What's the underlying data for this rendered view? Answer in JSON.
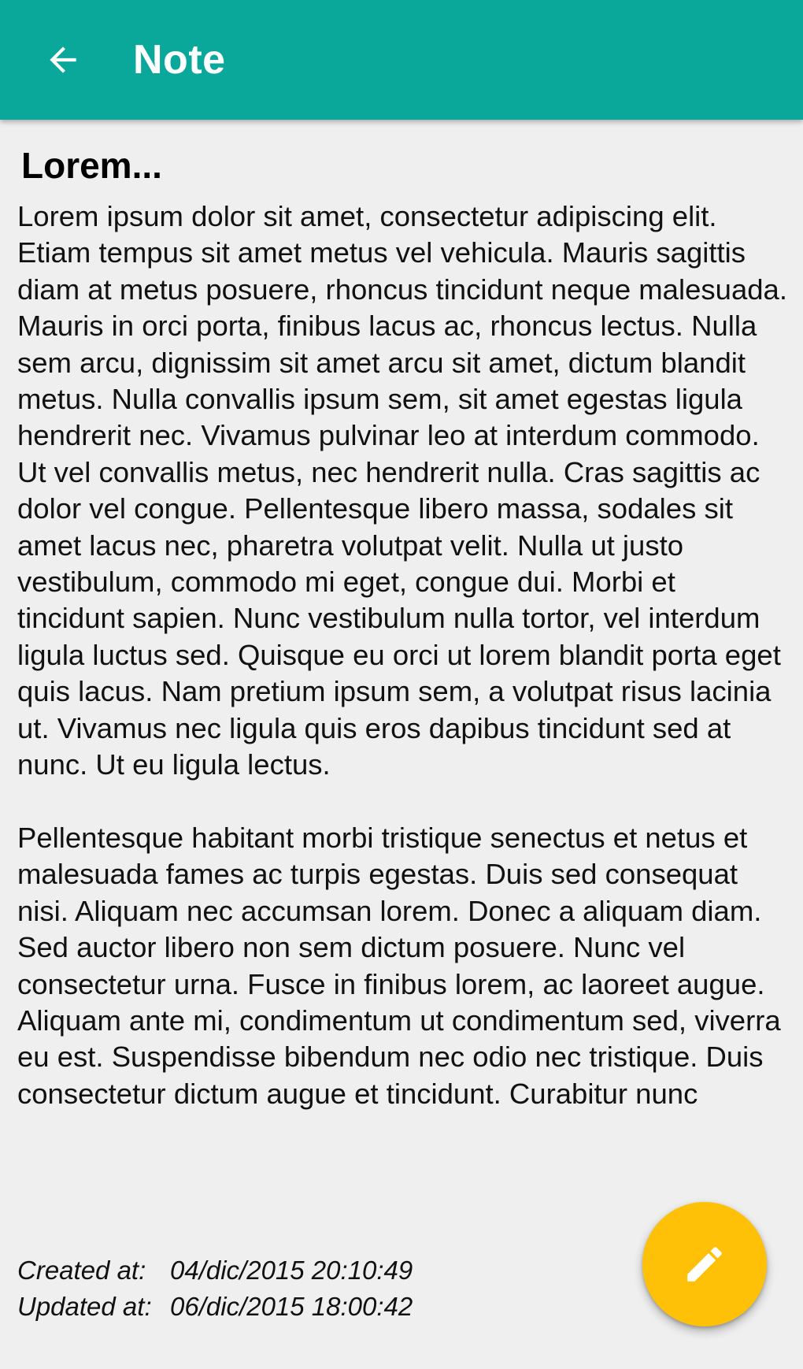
{
  "appbar": {
    "title": "Note",
    "back_icon": "arrow-left-icon",
    "background_color": "#0aa89a"
  },
  "note": {
    "title": "Lorem...",
    "body": "Lorem ipsum dolor sit amet, consectetur adipiscing elit. Etiam tempus sit amet metus vel vehicula. Mauris sagittis diam at metus posuere, rhoncus tincidunt neque malesuada. Mauris in orci porta, finibus lacus ac, rhoncus lectus. Nulla sem arcu, dignissim sit amet arcu sit amet, dictum blandit metus. Nulla convallis ipsum sem, sit amet egestas ligula hendrerit nec. Vivamus pulvinar leo at interdum commodo. Ut vel convallis metus, nec hendrerit nulla. Cras sagittis ac dolor vel congue. Pellentesque libero massa, sodales sit amet lacus nec, pharetra volutpat velit. Nulla ut justo vestibulum, commodo mi eget, congue dui. Morbi et tincidunt sapien. Nunc vestibulum nulla tortor, vel interdum ligula luctus sed. Quisque eu orci ut lorem blandit porta eget quis lacus. Nam pretium ipsum sem, a volutpat risus lacinia ut. Vivamus nec ligula quis eros dapibus tincidunt sed at nunc. Ut eu ligula lectus.\n\nPellentesque habitant morbi tristique senectus et netus et malesuada fames ac turpis egestas. Duis sed consequat nisi. Aliquam nec accumsan lorem. Donec a aliquam diam. Sed auctor libero non sem dictum posuere. Nunc vel consectetur urna. Fusce in finibus lorem, ac laoreet augue. Aliquam ante mi, condimentum ut condimentum sed, viverra eu est. Suspendisse bibendum nec odio nec tristique. Duis consectetur dictum augue et tincidunt. Curabitur nunc"
  },
  "meta": {
    "created_label": "Created at:",
    "created_value": "04/dic/2015 20:10:49",
    "updated_label": "Updated at:",
    "updated_value": "06/dic/2015 18:00:42"
  },
  "fab": {
    "icon": "pencil-icon",
    "color": "#ffc107"
  }
}
